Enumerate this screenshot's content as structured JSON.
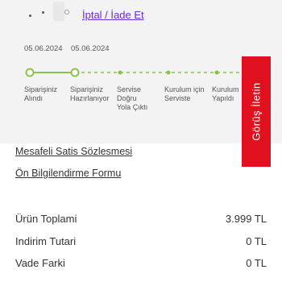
{
  "order": {
    "cancel_return_label": "İptal / İade Et",
    "dates": [
      "05.06.2024",
      "05.06.2024"
    ],
    "steps": [
      {
        "line1": "Siparişiniz",
        "line2": "Alındı",
        "line3": "",
        "status": "done"
      },
      {
        "line1": "Siparişiniz",
        "line2": "Hazırlanıyor",
        "line3": "",
        "status": "done"
      },
      {
        "line1": "Servise",
        "line2": "Doğru",
        "line3": "Yola Çıktı",
        "status": "pending"
      },
      {
        "line1": "Kurulum için",
        "line2": "Serviste",
        "line3": "",
        "status": "pending"
      },
      {
        "line1": "Kurulum",
        "line2": "Yapıldı",
        "line3": "",
        "status": "pending"
      }
    ]
  },
  "feedback": {
    "label": "Görüş İletin"
  },
  "documents": {
    "distance_sales": "Mesafeli Satis Sözlesmesi",
    "preliminary_info": "Ön Bilgilendirme Formu"
  },
  "summary": {
    "rows": [
      {
        "label": "Ürün Toplami",
        "value": "3.999 TL"
      },
      {
        "label": "Indirim Tutari",
        "value": "0 TL"
      },
      {
        "label": "Vade Farki",
        "value": "0 TL"
      }
    ]
  },
  "colors": {
    "accent": "#6b2bd9",
    "progress": "#8bc34a",
    "feedback_bg": "#e0101e"
  }
}
